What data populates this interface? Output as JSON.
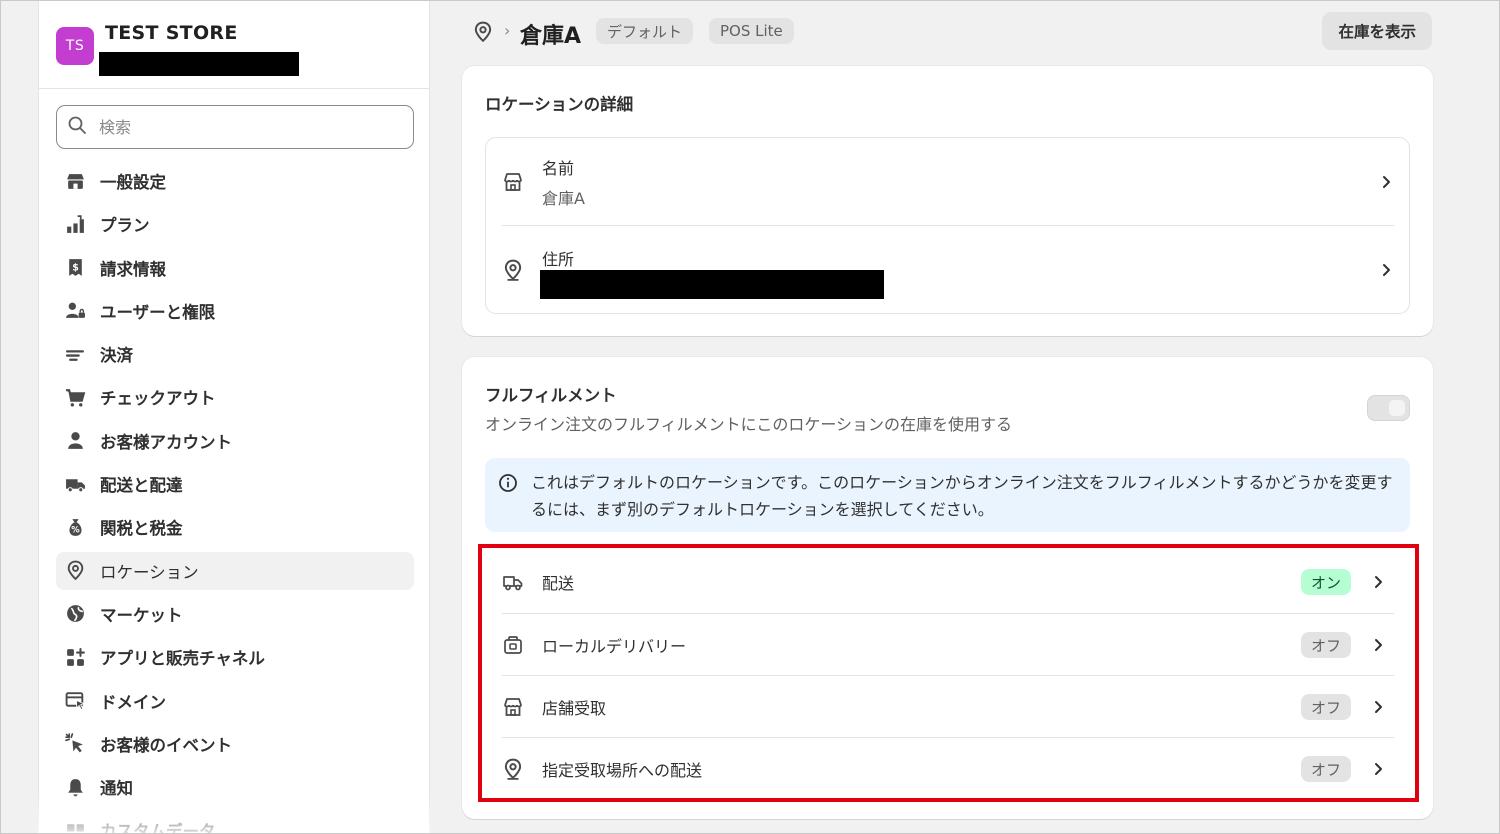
{
  "store": {
    "initials": "TS",
    "name": "TEST STORE"
  },
  "search": {
    "placeholder": "検索",
    "value": ""
  },
  "sidebar": {
    "items": [
      {
        "label": "一般設定",
        "icon": "store-icon"
      },
      {
        "label": "プラン",
        "icon": "plan-icon"
      },
      {
        "label": "請求情報",
        "icon": "receipt-icon"
      },
      {
        "label": "ユーザーと権限",
        "icon": "users-lock-icon"
      },
      {
        "label": "決済",
        "icon": "payment-icon"
      },
      {
        "label": "チェックアウト",
        "icon": "cart-icon"
      },
      {
        "label": "お客様アカウント",
        "icon": "person-icon"
      },
      {
        "label": "配送と配達",
        "icon": "truck-icon"
      },
      {
        "label": "関税と税金",
        "icon": "money-bag-icon"
      },
      {
        "label": "ロケーション",
        "icon": "location-pin-icon",
        "active": true
      },
      {
        "label": "マーケット",
        "icon": "globe-icon"
      },
      {
        "label": "アプリと販売チャネル",
        "icon": "apps-icon"
      },
      {
        "label": "ドメイン",
        "icon": "domain-icon"
      },
      {
        "label": "お客様のイベント",
        "icon": "cursor-click-icon"
      },
      {
        "label": "通知",
        "icon": "bell-icon"
      },
      {
        "label": "カスタムデータ",
        "icon": "data-icon"
      }
    ]
  },
  "header": {
    "separator": "›",
    "title": "倉庫A",
    "chips": [
      "デフォルト",
      "POS Lite"
    ],
    "view_inventory": "在庫を表示"
  },
  "details": {
    "title": "ロケーションの詳細",
    "name_label": "名前",
    "name_value": "倉庫A",
    "address_label": "住所"
  },
  "fulfillment": {
    "title": "フルフィルメント",
    "description": "オンライン注文のフルフィルメントにこのロケーションの在庫を使用する",
    "toggle_on": false,
    "banner": "これはデフォルトのロケーションです。このロケーションからオンライン注文をフルフィルメントするかどうかを変更するには、まず別のデフォルトロケーションを選択してください。",
    "methods": [
      {
        "label": "配送",
        "status": "オン",
        "on": true,
        "icon": "truck-icon"
      },
      {
        "label": "ローカルデリバリー",
        "status": "オフ",
        "on": false,
        "icon": "local-delivery-icon"
      },
      {
        "label": "店舗受取",
        "status": "オフ",
        "on": false,
        "icon": "store-icon"
      },
      {
        "label": "指定受取場所への配送",
        "status": "オフ",
        "on": false,
        "icon": "location-pin-icon"
      }
    ],
    "highlight_color": "#e0000f"
  }
}
